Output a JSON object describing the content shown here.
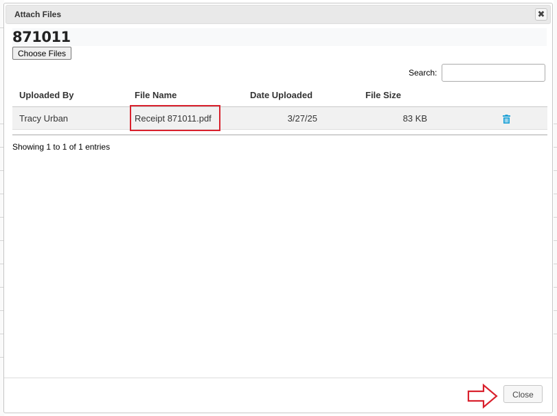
{
  "dialog": {
    "title": "Attach Files",
    "close_icon": "close-x-icon",
    "doc_number": "871011",
    "choose_files_label": "Choose Files",
    "search": {
      "label": "Search:",
      "value": ""
    },
    "table": {
      "headers": [
        "Uploaded By",
        "File Name",
        "Date Uploaded",
        "File Size"
      ],
      "rows": [
        {
          "uploaded_by": "Tracy Urban",
          "file_name": "Receipt 871011.pdf",
          "date_uploaded": "3/27/25",
          "file_size": "83 KB",
          "action_icon": "trash-icon"
        }
      ]
    },
    "info": "Showing 1 to 1 of 1 entries",
    "close_label": "Close"
  },
  "annotation": {
    "highlight_color": "#d9202c",
    "arrow_icon": "right-arrow-outline-icon"
  },
  "colors": {
    "accent_icon": "#1ea1d6",
    "titlebar_bg": "#e9e9e9"
  }
}
